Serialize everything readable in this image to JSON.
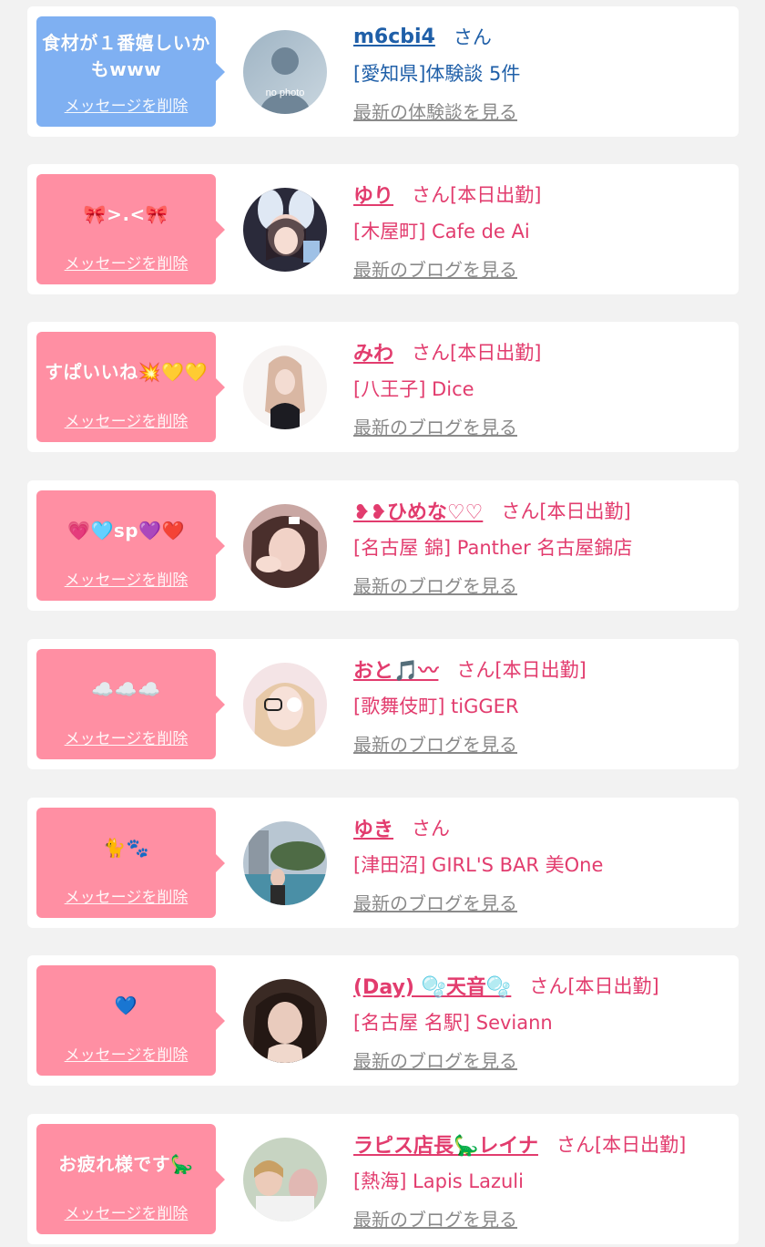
{
  "items": [
    {
      "theme": "blue",
      "bubble_color": "#7fb0f2",
      "message": "食材が１番嬉しいかもwww",
      "delete_label": "メッセージを削除",
      "name": "m6cbi4",
      "honorific": "さん",
      "status": "",
      "shop": "[愛知県]体験談 5件",
      "more_label": "最新の体験談を見る",
      "avatar": "no-photo"
    },
    {
      "theme": "pink",
      "bubble_color": "#ff8fa3",
      "message": "🎀>.<🎀",
      "delete_label": "メッセージを削除",
      "name": "ゆり",
      "honorific": "さん",
      "status": "[本日出勤]",
      "shop": "[木屋町] Cafe de Ai",
      "more_label": "最新のブログを見る",
      "avatar": "photo"
    },
    {
      "theme": "pink",
      "bubble_color": "#ff8fa3",
      "message": "すぱいいね💥💛💛",
      "delete_label": "メッセージを削除",
      "name": "みわ",
      "honorific": "さん",
      "status": "[本日出勤]",
      "shop": "[八王子] Dice",
      "more_label": "最新のブログを見る",
      "avatar": "photo"
    },
    {
      "theme": "pink",
      "bubble_color": "#ff8fa3",
      "message": "💗🩵sp💜❤️",
      "delete_label": "メッセージを削除",
      "name": "❥❥ひめな♡♡",
      "honorific": "さん",
      "status": "[本日出勤]",
      "shop": "[名古屋 錦] Panther 名古屋錦店",
      "more_label": "最新のブログを見る",
      "avatar": "photo"
    },
    {
      "theme": "pink",
      "bubble_color": "#ff8fa3",
      "message": "☁️☁️☁️",
      "delete_label": "メッセージを削除",
      "name": "おと🎵〰",
      "honorific": "さん",
      "status": "[本日出勤]",
      "shop": "[歌舞伎町] tiGGER",
      "more_label": "最新のブログを見る",
      "avatar": "photo"
    },
    {
      "theme": "pink",
      "bubble_color": "#ff8fa3",
      "message": "🐈🐾",
      "delete_label": "メッセージを削除",
      "name": "ゆき",
      "honorific": "さん",
      "status": "",
      "shop": "[津田沼] GIRL'S BAR 美One",
      "more_label": "最新のブログを見る",
      "avatar": "photo"
    },
    {
      "theme": "pink",
      "bubble_color": "#ff8fa3",
      "message": "💙",
      "delete_label": "メッセージを削除",
      "name": "(Day) 🫧天音🫧",
      "honorific": "さん",
      "status": "[本日出勤]",
      "shop": "[名古屋 名駅] Seviann",
      "more_label": "最新のブログを見る",
      "avatar": "photo"
    },
    {
      "theme": "pink",
      "bubble_color": "#ff8fa3",
      "message": "お疲れ様です🦕",
      "delete_label": "メッセージを削除",
      "name": "ラピス店長🦕レイナ",
      "honorific": "さん",
      "status": "[本日出勤]",
      "shop": "[熱海] Lapis Lazuli",
      "more_label": "最新のブログを見る",
      "avatar": "photo"
    }
  ],
  "colors": {
    "pink_text": "#e23c6e",
    "blue_text": "#1f5fa8",
    "link_gray": "#8a8a8a",
    "page_bg": "#f2f2f2"
  }
}
